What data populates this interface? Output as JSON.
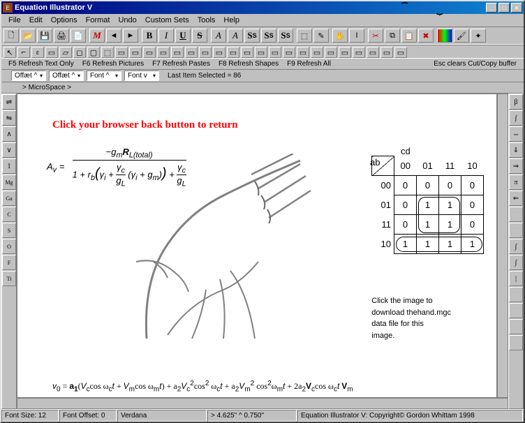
{
  "window": {
    "title": "Equation Illustrator V"
  },
  "menu": {
    "file": "File",
    "edit": "Edit",
    "options": "Options",
    "format": "Format",
    "undo": "Undo",
    "custom": "Custom Sets",
    "tools": "Tools",
    "help": "Help"
  },
  "toolbar2": {
    "f5": "F5 Refresh Text Only",
    "f6": "F6 Refresh Pictures",
    "f7": "F7 Refresh Pastes",
    "f8": "F8 Refresh Shapes",
    "f9": "F9 Refresh All",
    "esc": "Esc clears Cut/Copy buffer"
  },
  "toolbar3": {
    "combo1": "Offæt ^",
    "combo2": "Offæt ^",
    "combo3": "Font ^",
    "combo4": "Font v",
    "lastitem": "Last Item Selected = 86"
  },
  "breadcrumb": "> MicroSpace >",
  "canvas": {
    "redtext": "Click your browser back button to return",
    "download": {
      "l1": "Click the image to",
      "l2": "download thehand.mgc",
      "l3": "data file for this",
      "l4": "image."
    }
  },
  "chart_data": {
    "type": "table",
    "title": "Karnaugh map",
    "col_var": "cd",
    "row_var": "ab",
    "columns": [
      "00",
      "01",
      "11",
      "10"
    ],
    "rows": [
      "00",
      "01",
      "11",
      "10"
    ],
    "cells": [
      [
        0,
        0,
        0,
        0
      ],
      [
        0,
        1,
        1,
        0
      ],
      [
        0,
        1,
        1,
        0
      ],
      [
        1,
        1,
        1,
        1
      ]
    ],
    "groups": [
      {
        "rows": [
          1,
          2
        ],
        "cols": [
          1,
          2
        ]
      },
      {
        "rows": [
          3
        ],
        "cols": [
          0,
          1,
          2,
          3
        ]
      }
    ]
  },
  "status": {
    "fontsize": "Font Size: 12",
    "fontoffset": "Font Offset: 0",
    "fontname": "Verdana",
    "coords": "> 4.625\"  ^ 0.750\"",
    "copyright": "Equation Illustrator V: Copyright© Gordon Whittam 1998"
  },
  "left_palette": [
    "⇌",
    "⇋",
    "∧",
    "∨",
    "1",
    "Mg",
    "Ga",
    "C",
    "S",
    "O",
    "F",
    "Ti"
  ],
  "right_palette": [
    "β",
    "∫",
    "⇔",
    "⇓",
    "⇒",
    "π",
    "⇐",
    "",
    "",
    "∫",
    "∫",
    "|",
    "",
    "",
    "",
    ""
  ]
}
